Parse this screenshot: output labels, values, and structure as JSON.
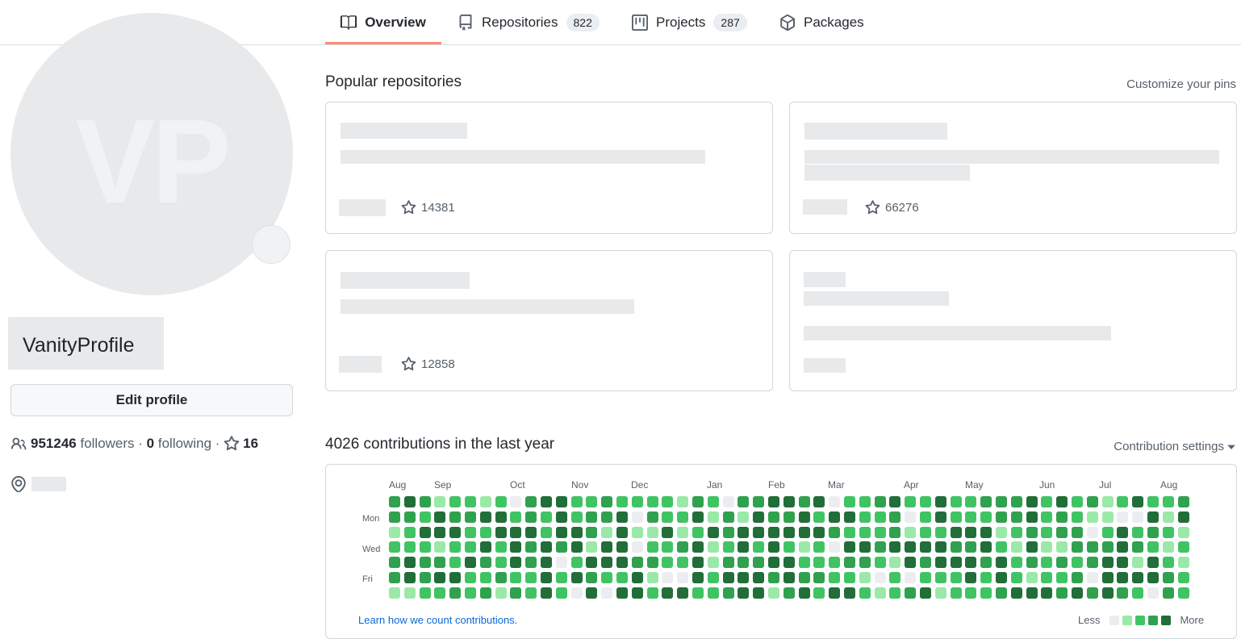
{
  "tabs": [
    {
      "label": "Overview",
      "selected": true,
      "icon": "book-icon"
    },
    {
      "label": "Repositories",
      "count": "822",
      "icon": "repo-icon"
    },
    {
      "label": "Projects",
      "count": "287",
      "icon": "project-icon"
    },
    {
      "label": "Packages",
      "icon": "package-icon"
    }
  ],
  "profile": {
    "initials": "VP",
    "name": "VanityProfile",
    "edit_label": "Edit profile",
    "followers": "951246",
    "followers_label": "followers",
    "following": "0",
    "following_label": "following",
    "stars": "16"
  },
  "popular": {
    "title": "Popular repositories",
    "customize": "Customize your pins",
    "cards": [
      {
        "stars": "14381"
      },
      {
        "stars": "66276"
      },
      {
        "stars": "12858"
      },
      {}
    ]
  },
  "contrib": {
    "title": "4026 contributions in the last year",
    "settings": "Contribution settings",
    "months": [
      "Aug",
      "Sep",
      "Oct",
      "Nov",
      "Dec",
      "Jan",
      "Feb",
      "Mar",
      "Apr",
      "May",
      "Jun",
      "Jul",
      "Aug"
    ],
    "days": [
      "Mon",
      "Wed",
      "Fri"
    ],
    "learn": "Learn how we count contributions.",
    "less": "Less",
    "more": "More",
    "colors": [
      "#ebedf0",
      "#9be9a8",
      "#40c463",
      "#30a14e",
      "#216e39"
    ]
  }
}
